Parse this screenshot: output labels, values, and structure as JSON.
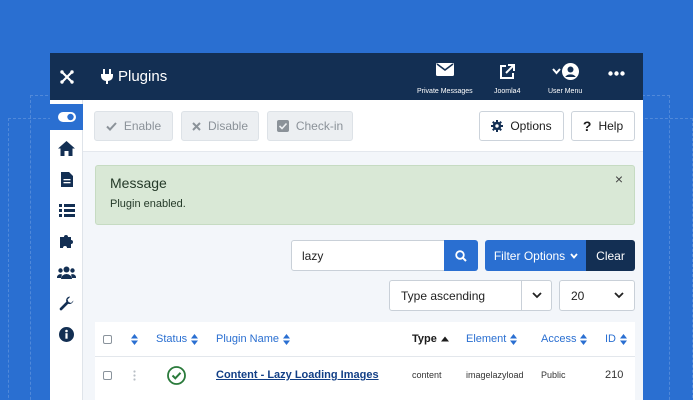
{
  "topbar": {
    "title": "Plugins",
    "items": [
      {
        "label": "Private Messages",
        "icon": "envelope-icon"
      },
      {
        "label": "Joomla4",
        "icon": "external-link-icon"
      },
      {
        "label": "User Menu",
        "icon": "user-circle-icon"
      }
    ],
    "more_icon": "ellipsis-icon"
  },
  "sidebar": {
    "items": [
      {
        "icon": "toggle-icon",
        "active": true
      },
      {
        "icon": "home-icon"
      },
      {
        "icon": "file-icon"
      },
      {
        "icon": "list-icon"
      },
      {
        "icon": "puzzle-icon"
      },
      {
        "icon": "users-icon"
      },
      {
        "icon": "wrench-icon"
      },
      {
        "icon": "info-icon"
      }
    ]
  },
  "toolbar": {
    "enable_label": "Enable",
    "disable_label": "Disable",
    "checkin_label": "Check-in",
    "options_label": "Options",
    "help_label": "Help"
  },
  "message": {
    "title": "Message",
    "text": "Plugin enabled.",
    "close": "×"
  },
  "search": {
    "value": "lazy",
    "filter_options_label": "Filter Options",
    "clear_label": "Clear"
  },
  "sort": {
    "ordering": "Type ascending",
    "limit": "20"
  },
  "table": {
    "headers": {
      "status": "Status",
      "plugin_name": "Plugin Name",
      "type": "Type",
      "element": "Element",
      "access": "Access",
      "id": "ID"
    },
    "rows": [
      {
        "name": "Content - Lazy Loading Images",
        "type": "content",
        "element": "imagelazyload",
        "access": "Public",
        "id": "210",
        "enabled": true
      }
    ]
  },
  "colors": {
    "accent": "#2a6fd1",
    "navbar": "#132f53",
    "success": "#2a7a3b"
  }
}
